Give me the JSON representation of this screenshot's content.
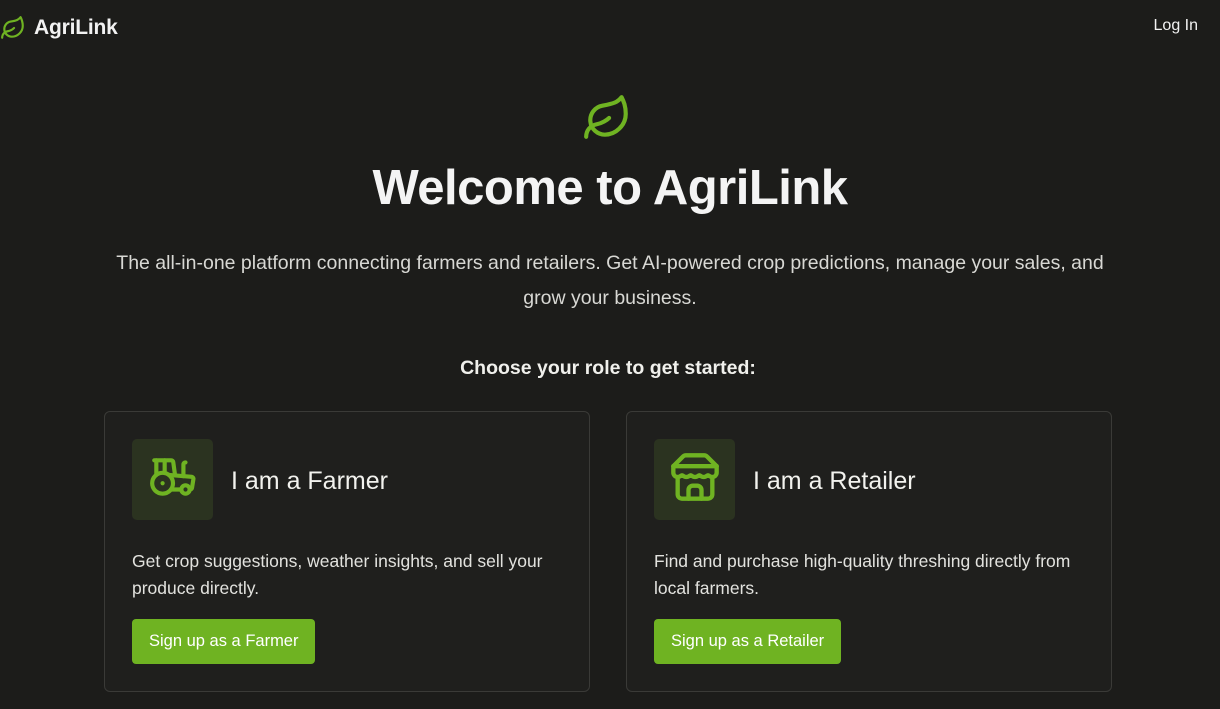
{
  "header": {
    "brand_name": "AgriLink",
    "brand_icon": "leaf-icon",
    "login_label": "Log In"
  },
  "hero": {
    "icon": "leaf-icon",
    "title": "Welcome to AgriLink",
    "subtitle": "The all-in-one platform connecting farmers and retailers. Get AI-powered crop predictions, manage your sales, and grow your business.",
    "role_prompt": "Choose your role to get started:"
  },
  "roles": [
    {
      "icon": "tractor-icon",
      "title": "I am a Farmer",
      "description": "Get crop suggestions, weather insights, and sell your produce directly.",
      "cta": "Sign up as a Farmer"
    },
    {
      "icon": "store-icon",
      "title": "I am a Retailer",
      "description": "Find and purchase high-quality threshing directly from local farmers.",
      "cta": "Sign up as a Retailer"
    }
  ],
  "colors": {
    "background": "#1c1c1a",
    "accent": "#6fb322",
    "icon_tile": "#2b3320",
    "card_border": "#3a3a37"
  }
}
